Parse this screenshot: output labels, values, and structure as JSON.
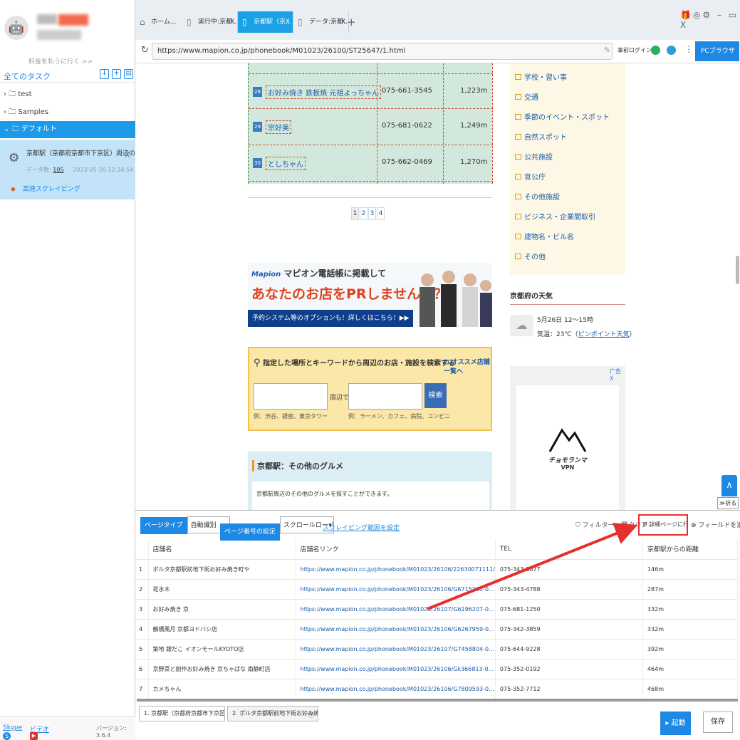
{
  "left": {
    "pay_label": "料金を払うに行く >>",
    "all_tasks": "全てのタスク",
    "tree": [
      {
        "label": "test",
        "prefix": "› 🗀 "
      },
      {
        "label": "Samples",
        "prefix": "› 🗀 "
      },
      {
        "label": "デフォルト",
        "prefix": "⌄ 🗀 "
      }
    ],
    "task": {
      "title": "京都駅（京都府京都市下京区）周辺のお好...",
      "count_label": "データ数:",
      "count": "105",
      "date": "2023-05-26 12:34:54",
      "mode": "高速スクレイピング"
    },
    "footer": {
      "skype": "Skype",
      "video": "ビデオ",
      "version": "バージョン: 3.6.4"
    }
  },
  "tabs": [
    {
      "label": "ホーム..."
    },
    {
      "label": "実行中:京都..."
    },
    {
      "label": "京都駅（京..."
    },
    {
      "label": "データ:京都..."
    }
  ],
  "addr": {
    "url": "https://www.mapion.co.jp/phonebook/M01023/26100/ST25647/1.html",
    "login": "事前ログイン",
    "pc_browser": "PCブラウザ"
  },
  "web": {
    "rows": [
      {
        "n": "28",
        "name": "お好み焼き 鉄板焼 元祖よっちゃん",
        "tel": "075-661-3545",
        "dist": "1,223m"
      },
      {
        "n": "29",
        "name": "宗好美",
        "tel": "075-681-0622",
        "dist": "1,249m"
      },
      {
        "n": "30",
        "name": "としちゃん",
        "tel": "075-662-0469",
        "dist": "1,270m"
      }
    ],
    "pages": [
      "1",
      "2",
      "3",
      "4"
    ],
    "banner": {
      "line1": "マピオン電話帳に掲載して",
      "line2": "あなたのお店をPRしませんか？",
      "line3": "予約システム等のオプションも！詳しくはこちら！▶▶",
      "logo": "Mapion"
    },
    "search": {
      "heading": "指定した場所とキーワードから周辺のお店・施設を検索する",
      "link": "オススメ店舗一覧へ",
      "near": "周辺で",
      "button": "検索",
      "ex1": "例：渋谷、銀座、東京タワー",
      "ex2": "例：ラーメン、カフェ、病院、コンビニ"
    },
    "gourmet": {
      "heading": "京都駅：その他のグルメ",
      "body": "京都駅周辺のその他のグルメを探すことができます。"
    },
    "categories": [
      "学校・習い事",
      "交通",
      "季節のイベント・スポット",
      "自然スポット",
      "公共施設",
      "官公庁",
      "その他施設",
      "ビジネス・企業間取引",
      "建物名・ビル名",
      "その他"
    ],
    "weather": {
      "heading": "京都府の天気",
      "line1": "5月26日 12〜15時",
      "line2_prefix": "気温：23℃（",
      "line2_link": "ピンポイント天気",
      "line2_suffix": "）"
    },
    "ad": {
      "tag": "广告 X",
      "brand": "チョモランマ",
      "sub": "VPN"
    },
    "fold": "≫折る"
  },
  "panel": {
    "page_type_label": "ページタイプ",
    "page_type_value": "自動識別",
    "paging_label": "ページ番号の設定",
    "paging_value": "スクロールローディング",
    "scrape_range": "スクレイピング範囲を設定",
    "filter": "フィルター",
    "clear": "クリア",
    "detail": "詳細ページに行く",
    "add_field": "フィールドを追加",
    "columns": [
      "店舗名",
      "店舗名リンク",
      "TEL",
      "京都駅からの距離"
    ],
    "rows": [
      {
        "i": "1",
        "name": "ポルタ京都駅前地下街お好み焼き町や",
        "link": "https://www.mapion.co.jp/phonebook/M01023/26106/22630071111/",
        "tel": "075-343-3077",
        "dist": "146m"
      },
      {
        "i": "2",
        "name": "花水木",
        "link": "https://www.mapion.co.jp/phonebook/M01023/26106/G6715261-0...",
        "tel": "075-343-4788",
        "dist": "287m"
      },
      {
        "i": "3",
        "name": "お好み焼き 京",
        "link": "https://www.mapion.co.jp/phonebook/M01023/26107/G6196207-0...",
        "tel": "075-681-1250",
        "dist": "332m"
      },
      {
        "i": "4",
        "name": "鶴橋風月 京都ヨドバシ店",
        "link": "https://www.mapion.co.jp/phonebook/M01023/26106/G6267959-0...",
        "tel": "075-342-3859",
        "dist": "332m"
      },
      {
        "i": "5",
        "name": "築地 銀だこ イオンモールKYOTO店",
        "link": "https://www.mapion.co.jp/phonebook/M01023/26107/G7458804-0...",
        "tel": "075-644-9228",
        "dist": "392m"
      },
      {
        "i": "6",
        "name": "京野菜と創作お好み焼き 京ちゃばな 南静町店",
        "link": "https://www.mapion.co.jp/phonebook/M01023/26106/Gk366813-0...",
        "tel": "075-352-0192",
        "dist": "464m"
      },
      {
        "i": "7",
        "name": "カメちゃん",
        "link": "https://www.mapion.co.jp/phonebook/M01023/26106/G7809593-0...",
        "tel": "075-352-7712",
        "dist": "468m"
      }
    ],
    "bottom_tabs": [
      "1. 京都駅（京都府京都市下京区）...",
      "2. ポルタ京都駅前地下街お好み焼..."
    ],
    "run": "▸ 起動",
    "save": "保存"
  },
  "colors": {
    "accent": "#1e88e5",
    "highlight": "#e53030"
  }
}
